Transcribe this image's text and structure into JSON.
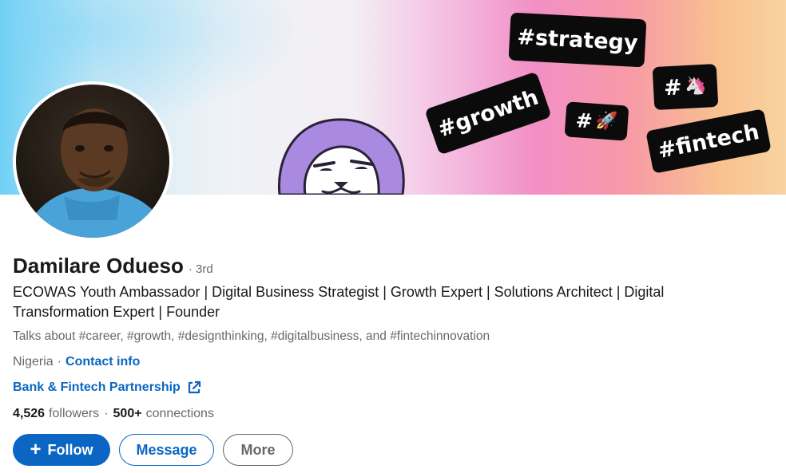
{
  "banner": {
    "tags": {
      "strategy": "#strategy",
      "growth": "#growth",
      "rocket": "#",
      "unicorn": "#",
      "fintech": "#fintech"
    },
    "emoji": {
      "rocket": "🚀",
      "unicorn": "🦄"
    }
  },
  "profile": {
    "name": "Damilare Odueso",
    "degree": "· 3rd",
    "headline": "ECOWAS Youth Ambassador | Digital Business Strategist | Growth Expert | Solutions Architect | Digital Transformation Expert | Founder",
    "talks_about": "Talks about #career, #growth, #designthinking, #digitalbusiness, and #fintechinnovation",
    "location": "Nigeria",
    "separator": "·",
    "contact_info": "Contact info",
    "external_link": "Bank & Fintech Partnership",
    "followers_count": "4,526",
    "followers_label": "followers",
    "connections_sep": "·",
    "connections_count": "500+",
    "connections_label": "connections"
  },
  "actions": {
    "follow_icon": "+",
    "follow": "Follow",
    "message": "Message",
    "more": "More"
  },
  "colors": {
    "brand_blue": "#0a66c2",
    "tag_bg": "#0b0b0b",
    "mascot_purple": "#a98ae0"
  }
}
